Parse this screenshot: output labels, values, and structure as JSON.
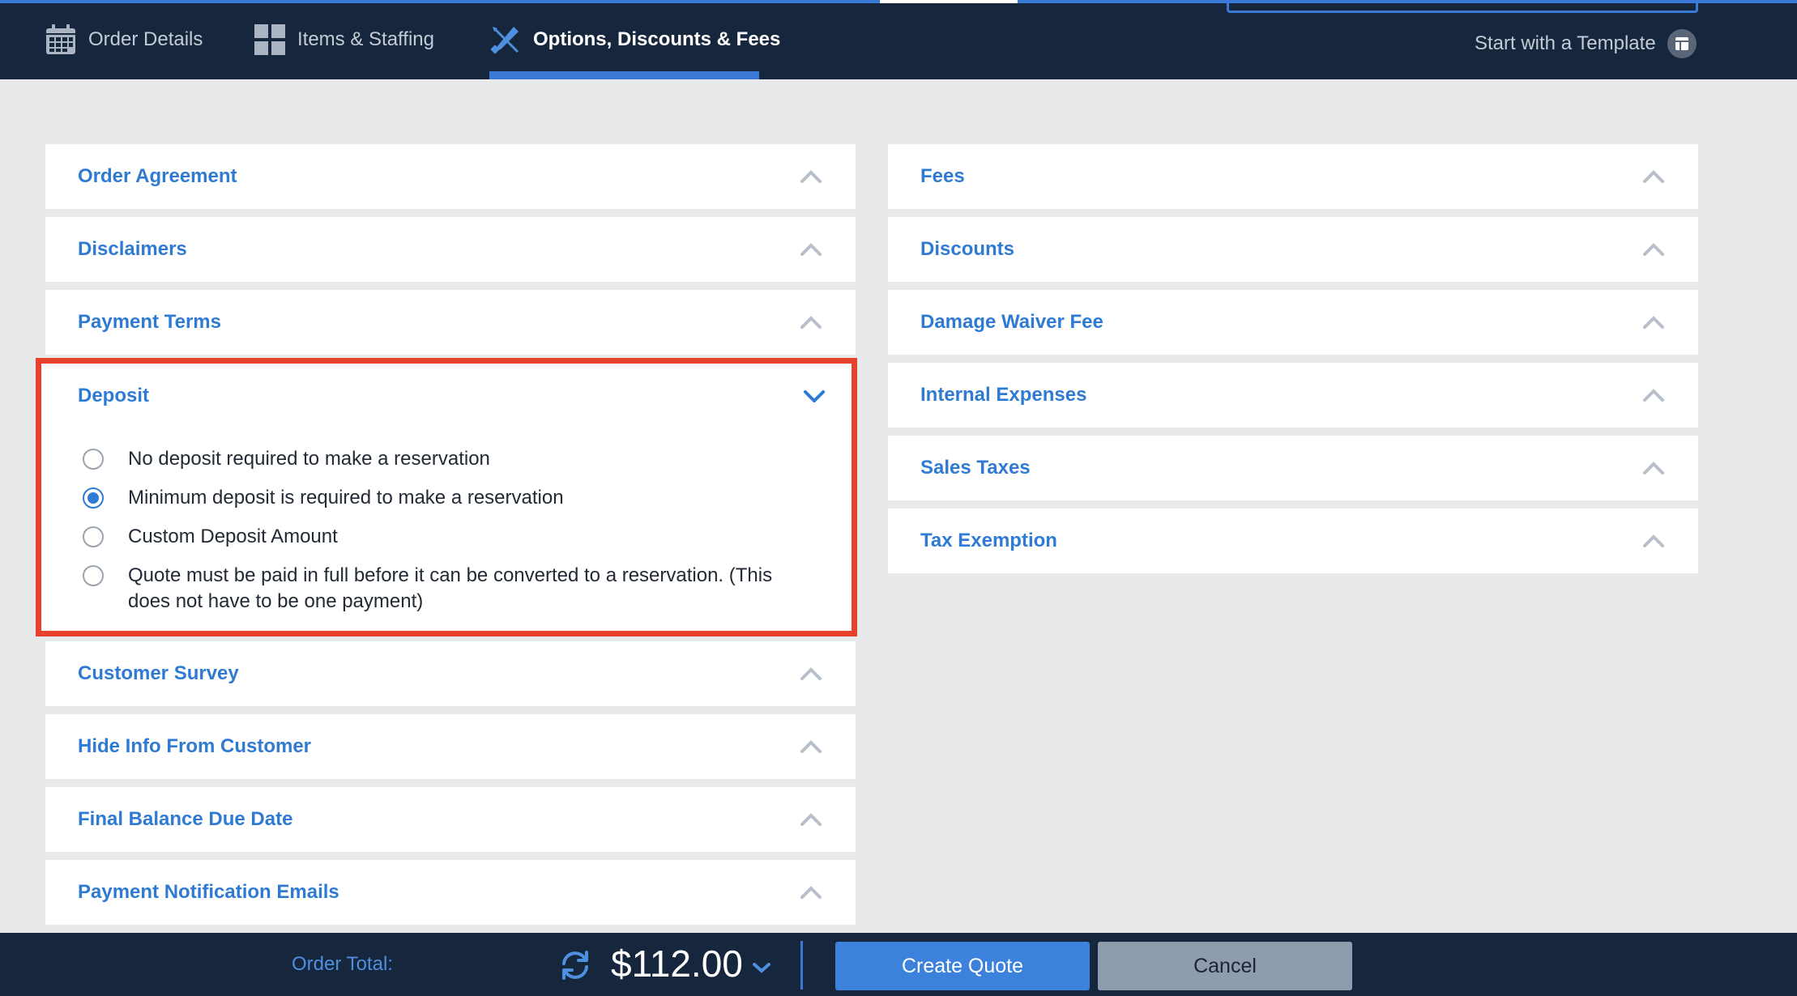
{
  "tabs": [
    {
      "label": "Order Details",
      "icon": "calendar-icon",
      "active": false
    },
    {
      "label": "Items & Staffing",
      "icon": "grid-icon",
      "active": false
    },
    {
      "label": "Options, Discounts & Fees",
      "icon": "tools-icon",
      "active": true
    }
  ],
  "template_link": {
    "label": "Start with a Template",
    "icon": "template-icon"
  },
  "left_panels": {
    "order_agreement": "Order Agreement",
    "disclaimers": "Disclaimers",
    "payment_terms": "Payment Terms",
    "customer_survey": "Customer Survey",
    "hide_info": "Hide Info From Customer",
    "final_balance": "Final Balance Due Date",
    "payment_emails": "Payment Notification Emails"
  },
  "deposit": {
    "title": "Deposit",
    "expanded": true,
    "options": [
      {
        "label": "No deposit required to make a reservation",
        "selected": false
      },
      {
        "label": "Minimum deposit is required to make a reservation",
        "selected": true
      },
      {
        "label": "Custom Deposit Amount",
        "selected": false
      },
      {
        "label": "Quote must be paid in full before it can be converted to a reservation. (This does not have to be one payment)",
        "selected": false
      }
    ]
  },
  "right_panels": {
    "fees": "Fees",
    "discounts": "Discounts",
    "damage_waiver": "Damage Waiver Fee",
    "internal_expenses": "Internal Expenses",
    "sales_taxes": "Sales Taxes",
    "tax_exemption": "Tax Exemption"
  },
  "footer": {
    "order_total_label": "Order Total:",
    "order_total_value": "$112.00",
    "create_label": "Create Quote",
    "cancel_label": "Cancel"
  },
  "colors": {
    "nav_bg": "#16273d",
    "accent": "#3a7ad6",
    "panel_title": "#2f7bd4",
    "highlight": "#e8412d",
    "page_bg": "#e8e9eb"
  }
}
